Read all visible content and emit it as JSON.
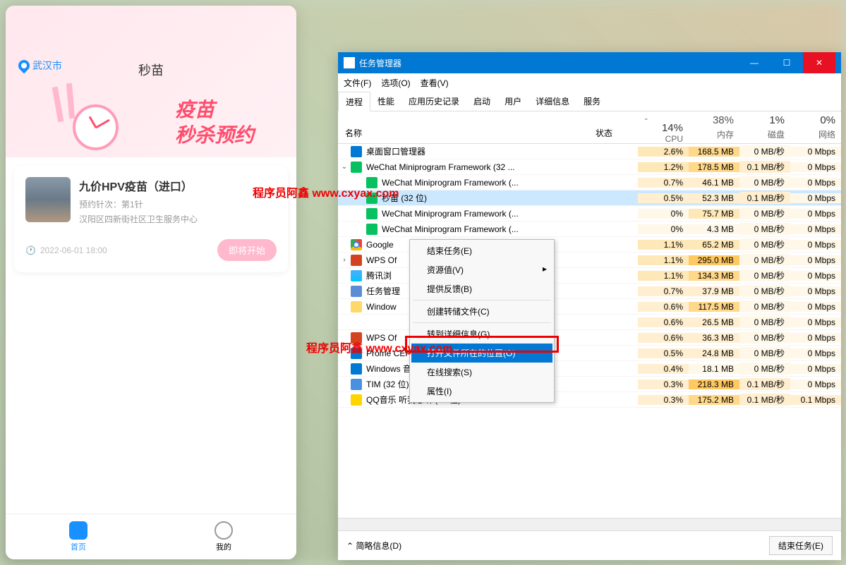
{
  "mini": {
    "location": "武汉市",
    "title": "秒苗",
    "hero_line1": "疫苗",
    "hero_line2": "秒杀预约",
    "card": {
      "name": "九价HPV疫苗（进口）",
      "dose": "预约针次：第1针",
      "address": "汉阳区四新街社区卫生服务中心",
      "time": "2022-06-01 18:00",
      "btn": "即将开始"
    },
    "nav_home": "首页",
    "nav_me": "我的"
  },
  "tm": {
    "title": "任务管理器",
    "menu_file": "文件(F)",
    "menu_opt": "选项(O)",
    "menu_view": "查看(V)",
    "tabs": [
      "进程",
      "性能",
      "应用历史记录",
      "启动",
      "用户",
      "详细信息",
      "服务"
    ],
    "head_name": "名称",
    "head_status": "状态",
    "cols": [
      {
        "pct": "14%",
        "lbl": "CPU"
      },
      {
        "pct": "38%",
        "lbl": "内存"
      },
      {
        "pct": "1%",
        "lbl": "磁盘"
      },
      {
        "pct": "0%",
        "lbl": "网络"
      }
    ],
    "rows": [
      {
        "exp": "",
        "ic": "ic-win",
        "name": "桌面窗口管理器",
        "cpu": "2.6%",
        "mem": "168.5 MB",
        "disk": "0 MB/秒",
        "net": "0 Mbps",
        "ch": 0,
        "h": [
          "h2",
          "h3",
          "h0",
          "h0"
        ]
      },
      {
        "exp": "⌄",
        "ic": "ic-we",
        "name": "WeChat Miniprogram Framework (32 ...",
        "cpu": "1.2%",
        "mem": "178.5 MB",
        "disk": "0.1 MB/秒",
        "net": "0 Mbps",
        "ch": 0,
        "h": [
          "h2",
          "h3",
          "h1",
          "h0"
        ]
      },
      {
        "exp": "",
        "ic": "ic-we",
        "name": "WeChat Miniprogram Framework (...",
        "cpu": "0.7%",
        "mem": "46.1 MB",
        "disk": "0 MB/秒",
        "net": "0 Mbps",
        "ch": 1,
        "h": [
          "h1",
          "h1",
          "h0",
          "h0"
        ]
      },
      {
        "exp": "",
        "ic": "ic-we",
        "name": "秒苗 (32 位)",
        "cpu": "0.5%",
        "mem": "52.3 MB",
        "disk": "0.1 MB/秒",
        "net": "0 Mbps",
        "ch": 1,
        "sel": 1,
        "h": [
          "h1",
          "h1",
          "h1",
          "h0"
        ]
      },
      {
        "exp": "",
        "ic": "ic-we",
        "name": "WeChat Miniprogram Framework (...",
        "cpu": "0%",
        "mem": "75.7 MB",
        "disk": "0 MB/秒",
        "net": "0 Mbps",
        "ch": 1,
        "h": [
          "h0",
          "h2",
          "h0",
          "h0"
        ]
      },
      {
        "exp": "",
        "ic": "ic-we",
        "name": "WeChat Miniprogram Framework (...",
        "cpu": "0%",
        "mem": "4.3 MB",
        "disk": "0 MB/秒",
        "net": "0 Mbps",
        "ch": 1,
        "h": [
          "h0",
          "h0",
          "h0",
          "h0"
        ]
      },
      {
        "exp": "",
        "ic": "ic-chr",
        "name": "Google",
        "cpu": "1.1%",
        "mem": "65.2 MB",
        "disk": "0 MB/秒",
        "net": "0 Mbps",
        "ch": 0,
        "h": [
          "h2",
          "h2",
          "h0",
          "h0"
        ]
      },
      {
        "exp": "›",
        "ic": "ic-wps",
        "name": "WPS Of",
        "cpu": "1.1%",
        "mem": "295.0 MB",
        "disk": "0 MB/秒",
        "net": "0 Mbps",
        "ch": 0,
        "h": [
          "h2",
          "h4",
          "h0",
          "h0"
        ]
      },
      {
        "exp": "",
        "ic": "ic-qq",
        "name": "腾讯浏",
        "cpu": "1.1%",
        "mem": "134.3 MB",
        "disk": "0 MB/秒",
        "net": "0 Mbps",
        "ch": 0,
        "h": [
          "h2",
          "h3",
          "h0",
          "h0"
        ]
      },
      {
        "exp": "",
        "ic": "ic-tm",
        "name": "任务管理",
        "cpu": "0.7%",
        "mem": "37.9 MB",
        "disk": "0 MB/秒",
        "net": "0 Mbps",
        "ch": 0,
        "h": [
          "h1",
          "h1",
          "h0",
          "h0"
        ]
      },
      {
        "exp": "",
        "ic": "ic-fold",
        "name": "Window",
        "cpu": "0.6%",
        "mem": "117.5 MB",
        "disk": "0 MB/秒",
        "net": "0 Mbps",
        "ch": 0,
        "h": [
          "h1",
          "h3",
          "h0",
          "h0"
        ]
      },
      {
        "exp": "",
        "ic": "",
        "name": "",
        "cpu": "0.6%",
        "mem": "26.5 MB",
        "disk": "0 MB/秒",
        "net": "0 Mbps",
        "ch": 0,
        "h": [
          "h1",
          "h1",
          "h0",
          "h0"
        ]
      },
      {
        "exp": "",
        "ic": "ic-wps",
        "name": "WPS Of",
        "cpu": "0.6%",
        "mem": "36.3 MB",
        "disk": "0 MB/秒",
        "net": "0 Mbps",
        "ch": 0,
        "h": [
          "h1",
          "h1",
          "h0",
          "h0"
        ]
      },
      {
        "exp": "",
        "ic": "ic-win",
        "name": "Prome CEF SubProcess (32 位)",
        "cpu": "0.5%",
        "mem": "24.8 MB",
        "disk": "0 MB/秒",
        "net": "0 Mbps",
        "ch": 0,
        "h": [
          "h1",
          "h1",
          "h0",
          "h0"
        ]
      },
      {
        "exp": "",
        "ic": "ic-win",
        "name": "Windows 音频设备图形隔离",
        "cpu": "0.4%",
        "mem": "18.1 MB",
        "disk": "0 MB/秒",
        "net": "0 Mbps",
        "ch": 0,
        "h": [
          "h1",
          "h0",
          "h0",
          "h0"
        ]
      },
      {
        "exp": "",
        "ic": "ic-tim",
        "name": "TIM (32 位)",
        "cpu": "0.3%",
        "mem": "218.3 MB",
        "disk": "0.1 MB/秒",
        "net": "0 Mbps",
        "ch": 0,
        "h": [
          "h1",
          "h4",
          "h1",
          "h0"
        ]
      },
      {
        "exp": "",
        "ic": "ic-qm",
        "name": "QQ音乐 听我想听 (32 位)",
        "cpu": "0.3%",
        "mem": "175.2 MB",
        "disk": "0.1 MB/秒",
        "net": "0.1 Mbps",
        "ch": 0,
        "h": [
          "h1",
          "h3",
          "h1",
          "h1"
        ]
      }
    ],
    "brief": "简略信息(D)",
    "end": "结束任务(E)"
  },
  "ctx": {
    "items": [
      {
        "t": "结束任务(E)"
      },
      {
        "t": "资源值(V)",
        "arr": "▸"
      },
      {
        "t": "提供反馈(B)"
      },
      {
        "sep": 1
      },
      {
        "t": "创建转储文件(C)"
      },
      {
        "sep": 1
      },
      {
        "t": "转到详细信息(G)"
      },
      {
        "t": "打开文件所在的位置(O)",
        "sel": 1
      },
      {
        "t": "在线搜索(S)"
      },
      {
        "t": "属性(I)"
      }
    ]
  },
  "wm": "程序员阿鑫 www.cxyax.com"
}
